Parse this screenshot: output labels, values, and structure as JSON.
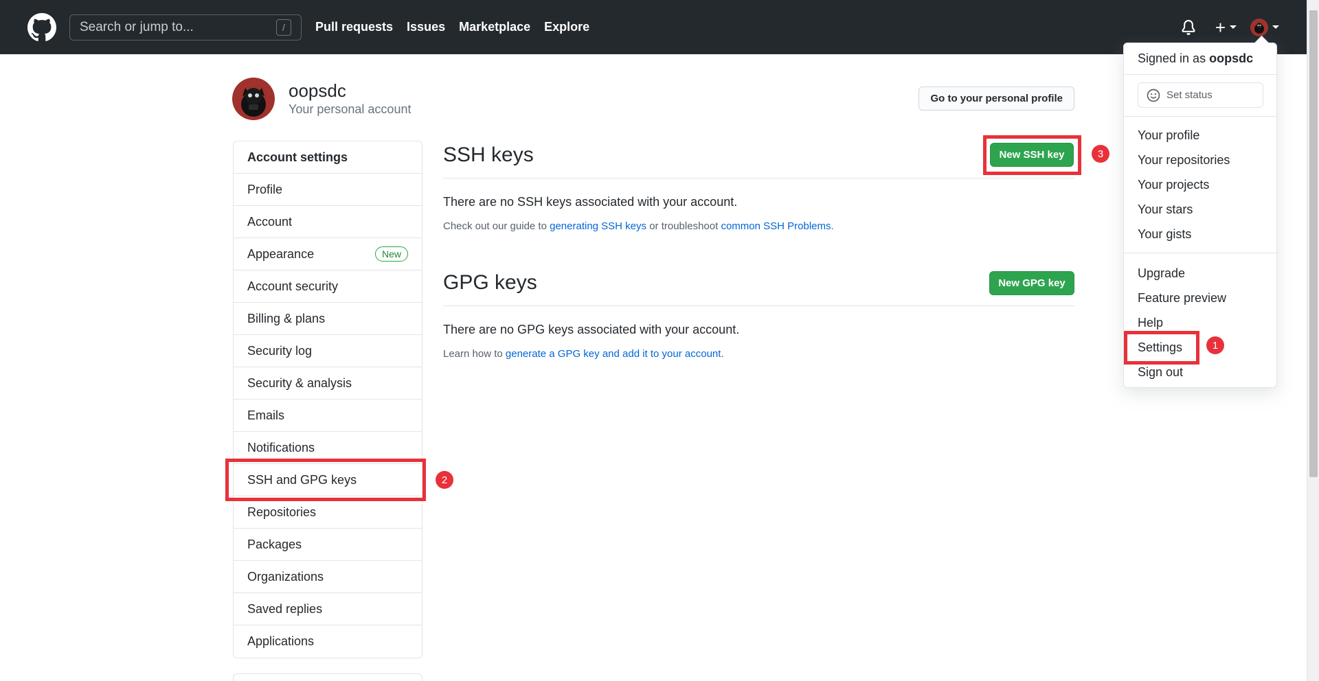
{
  "header": {
    "search_placeholder": "Search or jump to...",
    "search_shortcut": "/",
    "nav": [
      "Pull requests",
      "Issues",
      "Marketplace",
      "Explore"
    ],
    "plus_label": "+"
  },
  "profile": {
    "username": "oopsdc",
    "subtitle": "Your personal account",
    "go_profile_button": "Go to your personal profile"
  },
  "sidebar": {
    "title": "Account settings",
    "items": [
      {
        "label": "Profile"
      },
      {
        "label": "Account"
      },
      {
        "label": "Appearance",
        "badge": "New"
      },
      {
        "label": "Account security"
      },
      {
        "label": "Billing & plans"
      },
      {
        "label": "Security log"
      },
      {
        "label": "Security & analysis"
      },
      {
        "label": "Emails"
      },
      {
        "label": "Notifications"
      },
      {
        "label": "SSH and GPG keys",
        "selected": true
      },
      {
        "label": "Repositories"
      },
      {
        "label": "Packages"
      },
      {
        "label": "Organizations"
      },
      {
        "label": "Saved replies"
      },
      {
        "label": "Applications"
      }
    ]
  },
  "ssh": {
    "title": "SSH keys",
    "button": "New SSH key",
    "empty": "There are no SSH keys associated with your account.",
    "note_prefix": "Check out our guide to ",
    "note_link1": "generating SSH keys",
    "note_mid": " or troubleshoot ",
    "note_link2": "common SSH Problems",
    "note_suffix": "."
  },
  "gpg": {
    "title": "GPG keys",
    "button": "New GPG key",
    "empty": "There are no GPG keys associated with your account.",
    "note_prefix": "Learn how to ",
    "note_link": "generate a GPG key and add it to your account",
    "note_suffix": "."
  },
  "dropdown": {
    "signed_in_prefix": "Signed in as ",
    "signed_in_user": "oopsdc",
    "set_status": "Set status",
    "group1": [
      "Your profile",
      "Your repositories",
      "Your projects",
      "Your stars",
      "Your gists"
    ],
    "group2": [
      "Upgrade",
      "Feature preview",
      "Help",
      "Settings",
      "Sign out"
    ]
  },
  "annotations": [
    "1",
    "2",
    "3"
  ],
  "colors": {
    "header_bg": "#24292e",
    "primary_button": "#2ea44f",
    "link": "#0366d6",
    "annotation_red": "#e8313a"
  }
}
